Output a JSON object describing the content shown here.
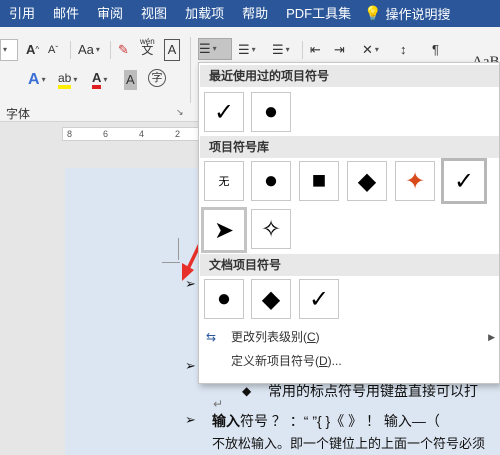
{
  "tabs": [
    "引用",
    "邮件",
    "审阅",
    "视图",
    "加载项",
    "帮助",
    "PDF工具集"
  ],
  "tell_me": "操作说明搜",
  "ribbon": {
    "aa_label": "Aa",
    "font_group_label": "字体",
    "style_preview": "AaB",
    "phonetic_label": "wén",
    "circle_char": "字",
    "char_border": "A"
  },
  "ruler_numbers": [
    "8",
    "6",
    "4",
    "2"
  ],
  "dropdown": {
    "recent_header": "最近使用过的项目符号",
    "library_header": "项目符号库",
    "doc_header": "文档项目符号",
    "recent": [
      {
        "name": "check-bullet",
        "glyph": "✓"
      },
      {
        "name": "round-bullet",
        "glyph": "●"
      }
    ],
    "library": [
      {
        "name": "none",
        "glyph": "无"
      },
      {
        "name": "round-bullet",
        "glyph": "●"
      },
      {
        "name": "square-bullet",
        "glyph": "■"
      },
      {
        "name": "diamond-bullet",
        "glyph": "◆"
      },
      {
        "name": "cross-star-bullet",
        "glyph": "✦"
      },
      {
        "name": "check-bullet",
        "glyph": "✓"
      },
      {
        "name": "arrow-bullet",
        "glyph": "➤"
      },
      {
        "name": "star4-bullet",
        "glyph": "✧"
      }
    ],
    "document": [
      {
        "name": "round-bullet",
        "glyph": "●"
      },
      {
        "name": "diamond-bullet",
        "glyph": "◆"
      },
      {
        "name": "check-bullet",
        "glyph": "✓"
      }
    ],
    "change_level_pre": "更改列表级别(",
    "change_level_key": "C",
    "change_level_post": ")",
    "define_new_pre": "定义新项目符号(",
    "define_new_key": "D",
    "define_new_post": ")..."
  },
  "document": {
    "line1": "常用的标点符号用键盘直接可以打",
    "line2_bold": "输入",
    "line2_rest": "符号 ？ ：“ ”{ }《 》 ！ 输入—（",
    "line3": "不放松输入。即一个键位上的上面一个符号必须",
    "return_mark": "↵"
  }
}
